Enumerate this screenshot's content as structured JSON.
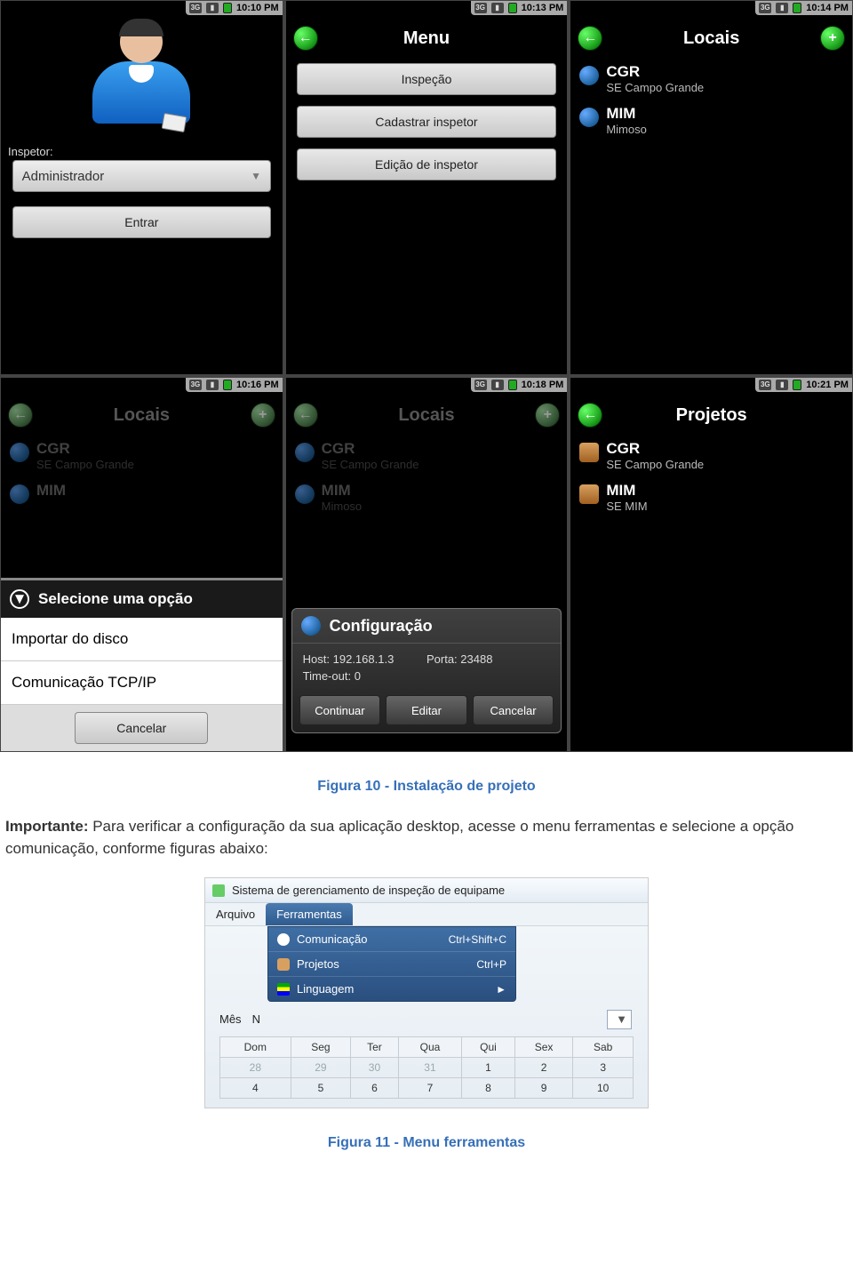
{
  "screens": [
    {
      "time": "10:10 PM",
      "inspector_label": "Inspetor:",
      "dropdown_value": "Administrador",
      "enter_btn": "Entrar"
    },
    {
      "time": "10:13 PM",
      "title": "Menu",
      "buttons": [
        "Inspeção",
        "Cadastrar inspetor",
        "Edição de inspetor"
      ]
    },
    {
      "time": "10:14 PM",
      "title": "Locais",
      "items": [
        {
          "title": "CGR",
          "sub": "SE Campo Grande"
        },
        {
          "title": "MIM",
          "sub": "Mimoso"
        }
      ]
    },
    {
      "time": "10:16 PM",
      "title": "Locais",
      "items": [
        {
          "title": "CGR",
          "sub": "SE Campo Grande"
        },
        {
          "title": "MIM",
          "sub": ""
        }
      ],
      "dialog": {
        "header": "Selecione uma opção",
        "opt1": "Importar do disco",
        "opt2": "Comunicação TCP/IP",
        "cancel": "Cancelar"
      }
    },
    {
      "time": "10:18 PM",
      "title": "Locais",
      "items": [
        {
          "title": "CGR",
          "sub": "SE Campo Grande"
        },
        {
          "title": "MIM",
          "sub": "Mimoso"
        }
      ],
      "config": {
        "header": "Configuração",
        "host_label": "Host:",
        "host": "192.168.1.3",
        "port_label": "Porta:",
        "port": "23488",
        "timeout_label": "Time-out:",
        "timeout": "0",
        "continue": "Continuar",
        "edit": "Editar",
        "cancel": "Cancelar"
      }
    },
    {
      "time": "10:21 PM",
      "title": "Projetos",
      "items": [
        {
          "title": "CGR",
          "sub": "SE Campo Grande"
        },
        {
          "title": "MIM",
          "sub": "SE MIM"
        }
      ]
    }
  ],
  "caption1": "Figura 10 - Instalação de projeto",
  "paragraph": {
    "strong": "Importante:",
    "rest": " Para verificar a configuração da sua aplicação desktop, acesse o menu ferramentas e selecione a opção comunicação, conforme figuras abaixo:"
  },
  "desktop": {
    "window_title": "Sistema de gerenciamento de inspeção de equipame",
    "menus": {
      "arquivo": "Arquivo",
      "ferramentas": "Ferramentas"
    },
    "submenu": [
      {
        "label": "Comunicação",
        "shortcut": "Ctrl+Shift+C"
      },
      {
        "label": "Projetos",
        "shortcut": "Ctrl+P"
      },
      {
        "label": "Linguagem",
        "shortcut": "►"
      }
    ],
    "mes_label": "Mês",
    "mes_value_prefix": "N",
    "calendar": {
      "headers": [
        "Dom",
        "Seg",
        "Ter",
        "Qua",
        "Qui",
        "Sex",
        "Sab"
      ],
      "rows": [
        {
          "cells": [
            "28",
            "29",
            "30",
            "31",
            "1",
            "2",
            "3"
          ],
          "grey_first": 4
        },
        {
          "cells": [
            "4",
            "5",
            "6",
            "7",
            "8",
            "9",
            "10"
          ],
          "grey_first": 0
        }
      ]
    }
  },
  "caption2": "Figura 11 - Menu ferramentas"
}
